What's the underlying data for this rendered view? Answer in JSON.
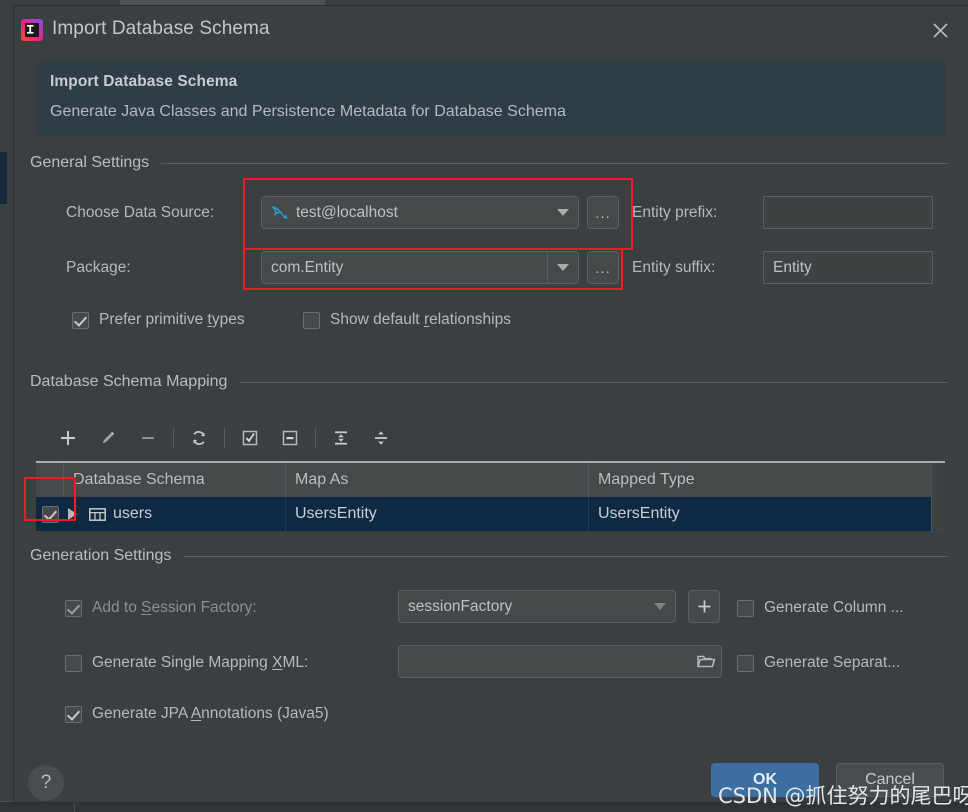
{
  "window": {
    "title": "Import Database Schema",
    "app_icon": "intellij-idea-icon",
    "close_icon": "close-icon"
  },
  "banner": {
    "title": "Import Database Schema",
    "subtitle": "Generate Java Classes and Persistence Metadata for Database Schema"
  },
  "general_settings": {
    "group_label": "General Settings",
    "data_source": {
      "label": "Choose Data Source:",
      "value": "test@localhost",
      "icon": "mysql-dolphin-icon",
      "browse_label": "..."
    },
    "package": {
      "label": "Package:",
      "value": "com.Entity",
      "browse_label": "..."
    },
    "entity_prefix": {
      "label": "Entity prefix:",
      "value": "",
      "placeholder": ""
    },
    "entity_suffix": {
      "label": "Entity suffix:",
      "value": "Entity"
    },
    "prefer_primitive_types": {
      "label_before": "Prefer primitive ",
      "mnemonic": "t",
      "label_after": "ypes",
      "checked": true
    },
    "show_default_relationships": {
      "label_before": "Show default ",
      "mnemonic": "r",
      "label_after": "elationships",
      "checked": false
    }
  },
  "schema_mapping": {
    "group_label": "Database Schema Mapping",
    "toolbar": [
      {
        "name": "add-icon",
        "glyph": "+"
      },
      {
        "name": "edit-pencil-icon",
        "glyph": "pencil"
      },
      {
        "name": "remove-icon",
        "glyph": "−"
      },
      {
        "name": "separator",
        "glyph": "sep"
      },
      {
        "name": "refresh-icon",
        "glyph": "refresh"
      },
      {
        "name": "separator",
        "glyph": "sep"
      },
      {
        "name": "select-all-icon",
        "glyph": "checkbox-checked"
      },
      {
        "name": "deselect-all-icon",
        "glyph": "checkbox-minus"
      },
      {
        "name": "separator",
        "glyph": "sep"
      },
      {
        "name": "expand-all-icon",
        "glyph": "expand"
      },
      {
        "name": "collapse-all-icon",
        "glyph": "collapse"
      }
    ],
    "columns": [
      "",
      "Database Schema",
      "Map As",
      "Mapped Type"
    ],
    "rows": [
      {
        "checked": true,
        "expandable": true,
        "icon": "table-icon",
        "database_schema": "users",
        "map_as": "UsersEntity",
        "mapped_type": "UsersEntity",
        "selected": true
      }
    ]
  },
  "generation_settings": {
    "group_label": "Generation Settings",
    "add_to_session_factory": {
      "label_before": "Add to ",
      "mnemonic": "S",
      "label_after": "ession Factory:",
      "checked": true,
      "disabled": true,
      "value": "sessionFactory",
      "add_button_label": "+"
    },
    "generate_single_mapping_xml": {
      "label_before": "Generate Single Mapping ",
      "mnemonic": "X",
      "label_after": "ML:",
      "checked": false,
      "value": "",
      "browse_icon": "folder-icon"
    },
    "generate_jpa_annotations": {
      "label_before": "Generate JPA ",
      "mnemonic": "A",
      "label_after": "nnotations (Java5)",
      "checked": true
    },
    "generate_column": {
      "label": "Generate Column ...",
      "checked": false
    },
    "generate_separate": {
      "label": "Generate Separat...",
      "checked": false
    }
  },
  "footer": {
    "help_label": "?",
    "ok_label": "OK",
    "cancel_label": "Cancel"
  },
  "watermark": "CSDN @抓住努力的尾巴呀",
  "colors": {
    "dialog_bg": "#3c3f41",
    "banner_bg": "#2f3d47",
    "accent_primary": "#3c6ea0",
    "row_selected": "#0d2a42",
    "annotation_red": "#ee1c25",
    "mysql_blue": "#2d9cdb"
  }
}
